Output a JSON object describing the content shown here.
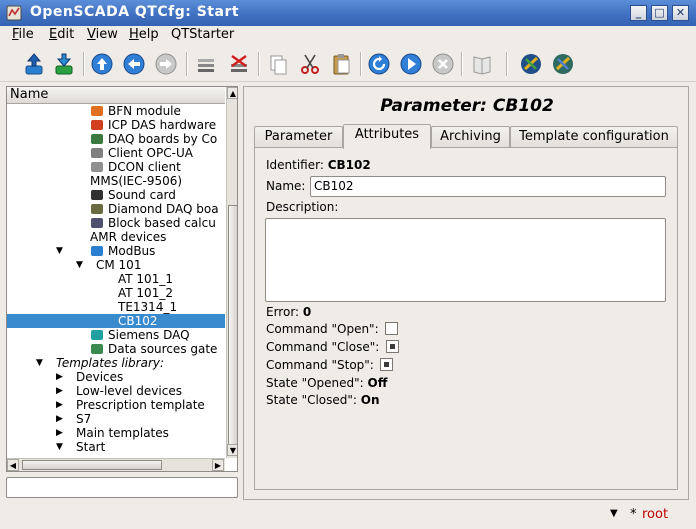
{
  "window": {
    "title": "OpenSCADA QTCfg: Start",
    "app_icon": "openscada-icon",
    "controls": {
      "minimize": "_",
      "maximize": "□",
      "close": "✕"
    }
  },
  "menu": [
    {
      "label": "File",
      "accel": "F",
      "rest": "ile"
    },
    {
      "label": "Edit",
      "accel": "E",
      "rest": "dit"
    },
    {
      "label": "View",
      "accel": "V",
      "rest": "iew"
    },
    {
      "label": "Help",
      "accel": "H",
      "rest": "elp"
    },
    {
      "label": "QTStarter",
      "accel": "",
      "rest": "QTStarter"
    }
  ],
  "toolbar": {
    "icons": [
      "load-icon",
      "save-icon",
      "up-icon",
      "back-icon",
      "forward-icon",
      "add-item-icon",
      "delete-item-icon",
      "copy-icon",
      "cut-icon",
      "paste-icon",
      "refresh-icon",
      "start-icon",
      "stop-icon",
      "manual-icon",
      "cfg-module-icon",
      "cfg-module2-icon"
    ]
  },
  "tree": {
    "header": "Name",
    "rows": [
      {
        "label": "BFN module",
        "icon": "bfn-icon",
        "level": 4
      },
      {
        "label": "ICP DAS hardware",
        "icon": "icpdas-icon",
        "level": 4
      },
      {
        "label": "DAQ boards by Co",
        "icon": "daqboard-icon",
        "level": 4
      },
      {
        "label": "Client OPC-UA",
        "icon": "opcua-icon",
        "level": 4
      },
      {
        "label": "DCON client",
        "icon": "dcon-icon",
        "level": 4
      },
      {
        "label": "MMS(IEC-9506)",
        "icon": "",
        "level": 4
      },
      {
        "label": "Sound card",
        "icon": "soundcard-icon",
        "level": 4
      },
      {
        "label": "Diamond DAQ boa",
        "icon": "diamond-icon",
        "level": 4
      },
      {
        "label": "Block based calcu",
        "icon": "blockcalc-icon",
        "level": 4
      },
      {
        "label": "AMR devices",
        "icon": "",
        "level": 4
      },
      {
        "label": "ModBus",
        "icon": "modbus-icon",
        "level": 4,
        "expanded": true
      },
      {
        "label": "CM 101",
        "icon": "",
        "level": 5,
        "expanded": true
      },
      {
        "label": "AT 101_1",
        "icon": "",
        "level": 6
      },
      {
        "label": "AT 101_2",
        "icon": "",
        "level": 6
      },
      {
        "label": "TE1314_1",
        "icon": "",
        "level": 6
      },
      {
        "label": "CB102",
        "icon": "",
        "level": 6,
        "selected": true
      },
      {
        "label": "Siemens DAQ",
        "icon": "siemens-icon",
        "level": 4
      },
      {
        "label": "Data sources gate",
        "icon": "gate-icon",
        "level": 4
      },
      {
        "label": "Templates library:",
        "icon": "",
        "level": 3,
        "expanded": true,
        "italic": true
      },
      {
        "label": "Devices",
        "icon": "",
        "level": 4,
        "collapsed": true
      },
      {
        "label": "Low-level devices",
        "icon": "",
        "level": 4,
        "collapsed": true
      },
      {
        "label": "Prescription template",
        "icon": "",
        "level": 4,
        "collapsed": true
      },
      {
        "label": "S7",
        "icon": "",
        "level": 4,
        "collapsed": true
      },
      {
        "label": "Main templates",
        "icon": "",
        "level": 4,
        "collapsed": true
      },
      {
        "label": "Start",
        "icon": "",
        "level": 4,
        "expanded": true
      }
    ]
  },
  "main": {
    "title": "Parameter: CB102",
    "tabs": [
      {
        "label": "Parameter"
      },
      {
        "label": "Attributes",
        "active": true
      },
      {
        "label": "Archiving"
      },
      {
        "label": "Template configuration"
      }
    ],
    "fields": {
      "identifier_label": "Identifier:",
      "identifier_value": "CB102",
      "name_label": "Name:",
      "name_value": "CB102",
      "description_label": "Description:",
      "description_value": "",
      "error_label": "Error:",
      "error_value": "0",
      "cmd_open_label": "Command \"Open\":",
      "cmd_open_state": "unchecked",
      "cmd_close_label": "Command \"Close\":",
      "cmd_close_state": "partial",
      "cmd_stop_label": "Command \"Stop\":",
      "cmd_stop_state": "partial",
      "state_opened_label": "State \"Opened\":",
      "state_opened_value": "Off",
      "state_closed_label": "State \"Closed\":",
      "state_closed_value": "On"
    }
  },
  "status": {
    "star": "*",
    "user": "root"
  },
  "colors": {
    "titlebar": "#3f6fc0",
    "selection": "#3a8ace",
    "user": "#c00000"
  }
}
